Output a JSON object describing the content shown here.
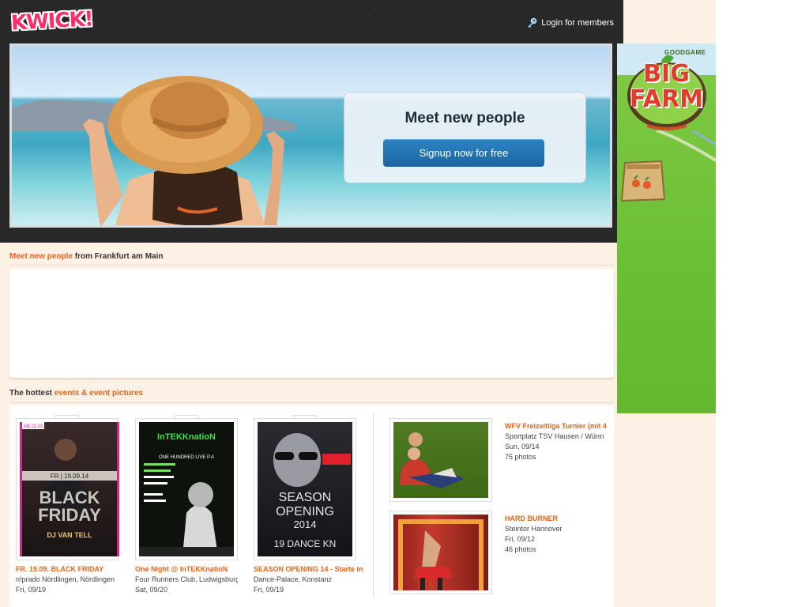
{
  "header": {
    "logo_text": "KWICK!",
    "login_label": "Login for members"
  },
  "hero": {
    "heading": "Meet new people",
    "signup_label": "Signup now for free"
  },
  "people_section": {
    "title_accent": "Meet new people",
    "title_rest": " from Frankfurt am Main"
  },
  "events_section": {
    "title_prefix": "The hottest ",
    "title_accent": "events & event pictures"
  },
  "events": [
    {
      "title": "FR. 19.09. BLACK FRIDAY",
      "location": "n!prado Nördlingen, Nördlingen",
      "date": "Fri, 09/19",
      "poster_text_1": "BLACK",
      "poster_text_2": "FRIDAY",
      "poster_text_3": "DJ VAN TELL",
      "poster_badge": "AB 22.00",
      "poster_date": "FR | 19.09.14"
    },
    {
      "title": "One Night @ InTEKKnatioN",
      "location": "Four Runners Club, Ludwigsburg",
      "date": "Sat, 09/20",
      "poster_text_1": "InTEKKnatioN",
      "poster_text_2": "ONE HUNDRED LIVE P.A"
    },
    {
      "title": "SEASON OPENING 14 - Starte in",
      "location": "Dance-Palace, Konstanz",
      "date": "Fri, 09/19",
      "poster_text_1": "SEASON",
      "poster_text_2": "OPENING",
      "poster_text_3": "2014",
      "poster_text_4": "19 DANCE KN"
    }
  ],
  "photo_albums": [
    {
      "title": "WFV Freizeitliga Turnier (mit 4",
      "location": "Sportplatz TSV Hausen / Würm",
      "date": "Sun, 09/14",
      "count": "75 photos"
    },
    {
      "title": "HARD BURNER",
      "location": "Steintor Hannover",
      "date": "Fri, 09/12",
      "count": "46 photos"
    }
  ],
  "ad": {
    "brand": "GOODGAME",
    "line1": "BIG",
    "line2": "FARM"
  },
  "colors": {
    "accent": "#e8631a",
    "header_bg": "#2b2b2b",
    "page_bg": "#fdf0e4",
    "button": "#1b64a0",
    "logo": "#ff2d6a"
  }
}
